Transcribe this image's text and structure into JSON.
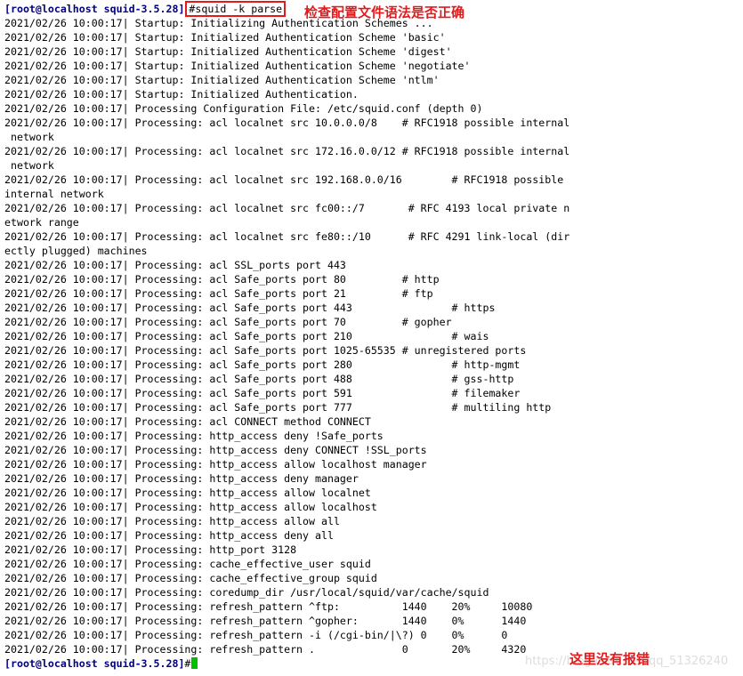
{
  "terminal": {
    "prompt": "[root@localhost squid-3.5.28]",
    "command": "#squid -k parse",
    "lines": [
      "2021/02/26 10:00:17| Startup: Initializing Authentication Schemes ...",
      "2021/02/26 10:00:17| Startup: Initialized Authentication Scheme 'basic'",
      "2021/02/26 10:00:17| Startup: Initialized Authentication Scheme 'digest'",
      "2021/02/26 10:00:17| Startup: Initialized Authentication Scheme 'negotiate'",
      "2021/02/26 10:00:17| Startup: Initialized Authentication Scheme 'ntlm'",
      "2021/02/26 10:00:17| Startup: Initialized Authentication.",
      "2021/02/26 10:00:17| Processing Configuration File: /etc/squid.conf (depth 0)",
      "2021/02/26 10:00:17| Processing: acl localnet src 10.0.0.0/8    # RFC1918 possible internal",
      " network",
      "2021/02/26 10:00:17| Processing: acl localnet src 172.16.0.0/12 # RFC1918 possible internal",
      " network",
      "2021/02/26 10:00:17| Processing: acl localnet src 192.168.0.0/16        # RFC1918 possible",
      "internal network",
      "2021/02/26 10:00:17| Processing: acl localnet src fc00::/7       # RFC 4193 local private n",
      "etwork range",
      "2021/02/26 10:00:17| Processing: acl localnet src fe80::/10      # RFC 4291 link-local (dir",
      "ectly plugged) machines",
      "2021/02/26 10:00:17| Processing: acl SSL_ports port 443",
      "2021/02/26 10:00:17| Processing: acl Safe_ports port 80         # http",
      "2021/02/26 10:00:17| Processing: acl Safe_ports port 21         # ftp",
      "2021/02/26 10:00:17| Processing: acl Safe_ports port 443                # https",
      "2021/02/26 10:00:17| Processing: acl Safe_ports port 70         # gopher",
      "2021/02/26 10:00:17| Processing: acl Safe_ports port 210                # wais",
      "2021/02/26 10:00:17| Processing: acl Safe_ports port 1025-65535 # unregistered ports",
      "2021/02/26 10:00:17| Processing: acl Safe_ports port 280                # http-mgmt",
      "2021/02/26 10:00:17| Processing: acl Safe_ports port 488                # gss-http",
      "2021/02/26 10:00:17| Processing: acl Safe_ports port 591                # filemaker",
      "2021/02/26 10:00:17| Processing: acl Safe_ports port 777                # multiling http",
      "2021/02/26 10:00:17| Processing: acl CONNECT method CONNECT",
      "2021/02/26 10:00:17| Processing: http_access deny !Safe_ports",
      "2021/02/26 10:00:17| Processing: http_access deny CONNECT !SSL_ports",
      "2021/02/26 10:00:17| Processing: http_access allow localhost manager",
      "2021/02/26 10:00:17| Processing: http_access deny manager",
      "2021/02/26 10:00:17| Processing: http_access allow localnet",
      "2021/02/26 10:00:17| Processing: http_access allow localhost",
      "2021/02/26 10:00:17| Processing: http_access allow all",
      "2021/02/26 10:00:17| Processing: http_access deny all",
      "2021/02/26 10:00:17| Processing: http_port 3128",
      "2021/02/26 10:00:17| Processing: cache_effective_user squid",
      "2021/02/26 10:00:17| Processing: cache_effective_group squid",
      "2021/02/26 10:00:17| Processing: coredump_dir /usr/local/squid/var/cache/squid",
      "2021/02/26 10:00:17| Processing: refresh_pattern ^ftp:          1440    20%     10080",
      "2021/02/26 10:00:17| Processing: refresh_pattern ^gopher:       1440    0%      1440",
      "2021/02/26 10:00:17| Processing: refresh_pattern -i (/cgi-bin/|\\?) 0    0%      0",
      "2021/02/26 10:00:17| Processing: refresh_pattern .              0       20%     4320"
    ],
    "final_prompt": "[root@localhost squid-3.5.28]",
    "final_symbol": "#"
  },
  "annotations": {
    "top": "检查配置文件语法是否正确",
    "bottom": "这里没有报错"
  },
  "watermark": "https://blog.csdn.net/qq_51326240",
  "colors": {
    "prompt": "#000080",
    "annotation": "#e31a1c",
    "cursor": "#00c000"
  }
}
